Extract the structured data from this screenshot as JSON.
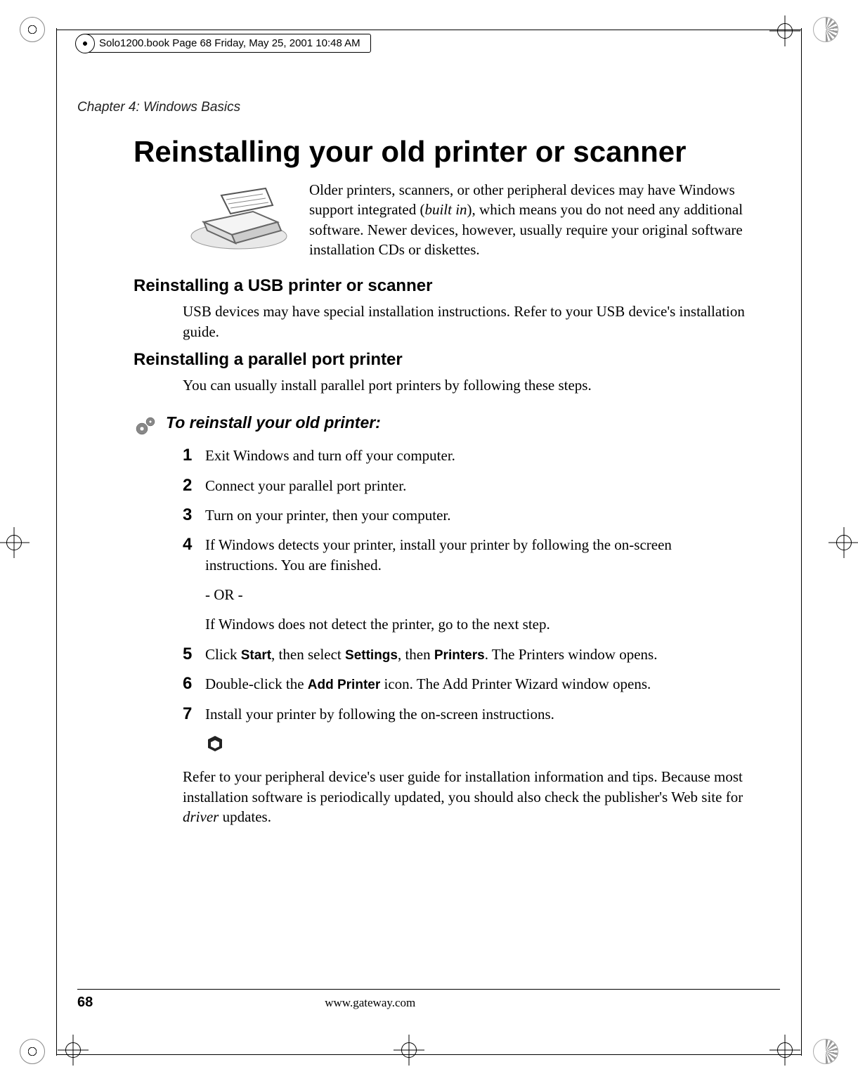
{
  "header_tag": "Solo1200.book  Page 68  Friday, May 25, 2001  10:48 AM",
  "chapter_label": "Chapter 4: Windows Basics",
  "main_title": "Reinstalling your old printer or scanner",
  "intro": {
    "pre": "Older printers, scanners, or other peripheral devices may have Windows support integrated (",
    "ital": "built in",
    "post": "), which means you do not need any additional software. Newer devices, however, usually require your original software installation CDs or diskettes."
  },
  "section1": {
    "heading": "Reinstalling a USB printer or scanner",
    "body": "USB devices may have special installation instructions. Refer to your USB device's installation guide."
  },
  "section2": {
    "heading": "Reinstalling a parallel port printer",
    "body": "You can usually install parallel port printers by following these steps."
  },
  "procedure": {
    "title": "To reinstall your old printer:",
    "steps": {
      "n1": "1",
      "t1": "Exit Windows and turn off your computer.",
      "n2": "2",
      "t2": "Connect your parallel port printer.",
      "n3": "3",
      "t3": "Turn on your printer, then your computer.",
      "n4": "4",
      "t4": "If Windows detects your printer, install your printer by following the on-screen instructions. You are finished.",
      "or": "- OR -",
      "t4b": "If Windows does not detect the printer, go to the next step.",
      "n5": "5",
      "t5_a": "Click ",
      "t5_b1": "Start",
      "t5_c": ", then select ",
      "t5_b2": "Settings",
      "t5_d": ", then ",
      "t5_b3": "Printers",
      "t5_e": ". The Printers window opens.",
      "n6": "6",
      "t6_a": "Double-click the ",
      "t6_b": "Add Printer",
      "t6_c": " icon. The Add Printer Wizard window opens.",
      "n7": "7",
      "t7": "Install your printer by following the on-screen instructions."
    }
  },
  "closing": {
    "pre": "Refer to your peripheral device's user guide for installation information and tips. Because most installation software is periodically updated, you should also check the publisher's Web site for ",
    "ital": "driver",
    "post": " updates."
  },
  "footer": {
    "page_num": "68",
    "url": "www.gateway.com"
  }
}
